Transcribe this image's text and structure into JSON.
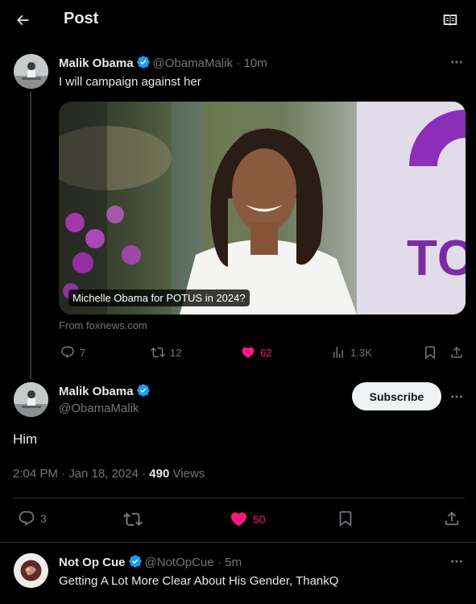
{
  "header": {
    "title": "Post"
  },
  "quoted_post": {
    "author_name": "Malik Obama",
    "handle": "@ObamaMalik",
    "time": "· 10m",
    "text": "I will campaign against her",
    "card_label": "Michelle Obama for POTUS in 2024?",
    "card_source": "From foxnews.com",
    "replies": "7",
    "reposts": "12",
    "likes": "62",
    "views": "1.3K"
  },
  "main_post": {
    "author_name": "Malik Obama",
    "handle": "@ObamaMalik",
    "subscribe_label": "Subscribe",
    "text": "Him",
    "timestamp": "2:04 PM · Jan 18, 2024 · ",
    "views_count": "490",
    "views_label": " Views",
    "replies": "3",
    "likes": "50"
  },
  "reply": {
    "author_name": "Not Op Cue",
    "handle": "@NotOpCue",
    "time": "· 5m",
    "text": "Getting A Lot More Clear About His Gender, ThankQ"
  },
  "colors": {
    "accent_blue": "#1d9bf0",
    "like_pink": "#f91880",
    "muted": "#71767b"
  }
}
